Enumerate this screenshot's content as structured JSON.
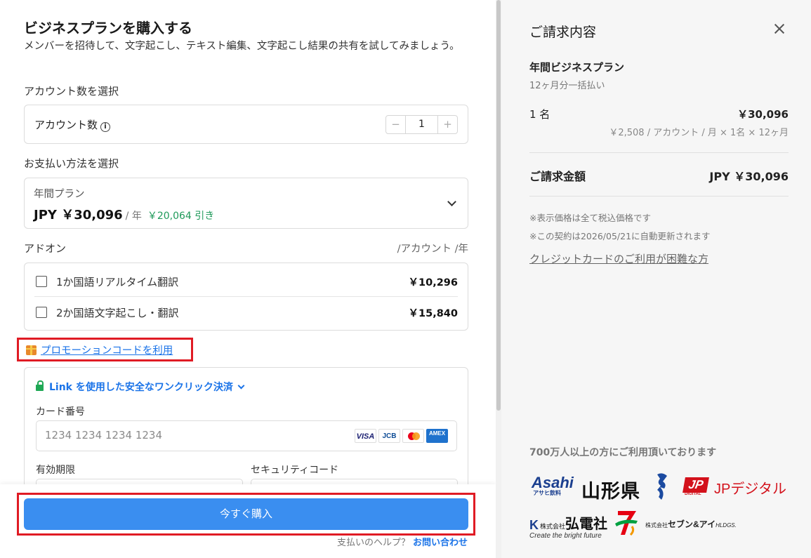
{
  "left": {
    "title": "ビジネスプランを購入する",
    "subtitle": "メンバーを招待して、文字起こし、テキスト編集、文字起こし結果の共有を試してみましょう。",
    "accounts_section": "アカウント数を選択",
    "accounts_label": "アカウント数",
    "accounts_info_icon": "i",
    "stepper": {
      "minus": "−",
      "value": "1",
      "plus": "+"
    },
    "payment_section": "お支払い方法を選択",
    "plan": {
      "name": "年間プラン",
      "price": "JPY ￥30,096",
      "per": "/ 年",
      "discount": "￥20,064 引き"
    },
    "addon_section": "アドオン",
    "addon_unit": "/アカウント /年",
    "addons": [
      {
        "name": "1か国語リアルタイム翻訳",
        "price": "￥10,296"
      },
      {
        "name": "2か国語文字起こし・翻訳",
        "price": "￥15,840"
      }
    ],
    "promo": "プロモーションコードを利用",
    "link_pay": "Link を使用した安全なワンクリック決済",
    "card_label": "カード番号",
    "card_placeholder": "1234 1234 1234 1234",
    "brands": {
      "visa": "VISA",
      "jcb": "JCB",
      "amex": "AMEX"
    },
    "exp_label": "有効期限",
    "cvc_label": "セキュリティコード",
    "buy_button": "今すぐ購入",
    "help_text": "支払いのヘルプ？",
    "help_link": "お問い合わせ"
  },
  "right": {
    "title": "ご請求内容",
    "plan": "年間ビジネスプラン",
    "plan_sub": "12ヶ月分一括払い",
    "seats": "1 名",
    "seats_price": "￥30,096",
    "calc": "￥2,508 / アカウント / 月 × 1名 × 12ヶ月",
    "total_label": "ご請求金額",
    "total": "JPY ￥30,096",
    "note1": "※表示価格は全て税込価格です",
    "note2": "※この契約は2026/05/21に自動更新されます",
    "card_difficulty_link": "クレジットカードのご利用が困難な方",
    "users_text": "700万人以上の方にご利用頂いております",
    "logos": {
      "asahi": "Asahi",
      "asahi_sub": "アサヒ飲料",
      "yamagata": "山形県",
      "jp_mark": "JP",
      "jp_small": "DIGITAL",
      "jp_text": "JPデジタル",
      "koden_mark": "K",
      "koden_prefix": "株式会社",
      "koden": "弘電社",
      "koden_sub": "Create the bright future",
      "seven_prefix": "株式会社",
      "seven": "セブン&アイ",
      "seven_suffix": "HLDGS."
    }
  },
  "colors": {
    "accent": "#3a8ef0",
    "link": "#1a73e8",
    "discount": "#1f9a5a",
    "highlight": "#e01b24",
    "right_bg": "#f6f6f6"
  }
}
